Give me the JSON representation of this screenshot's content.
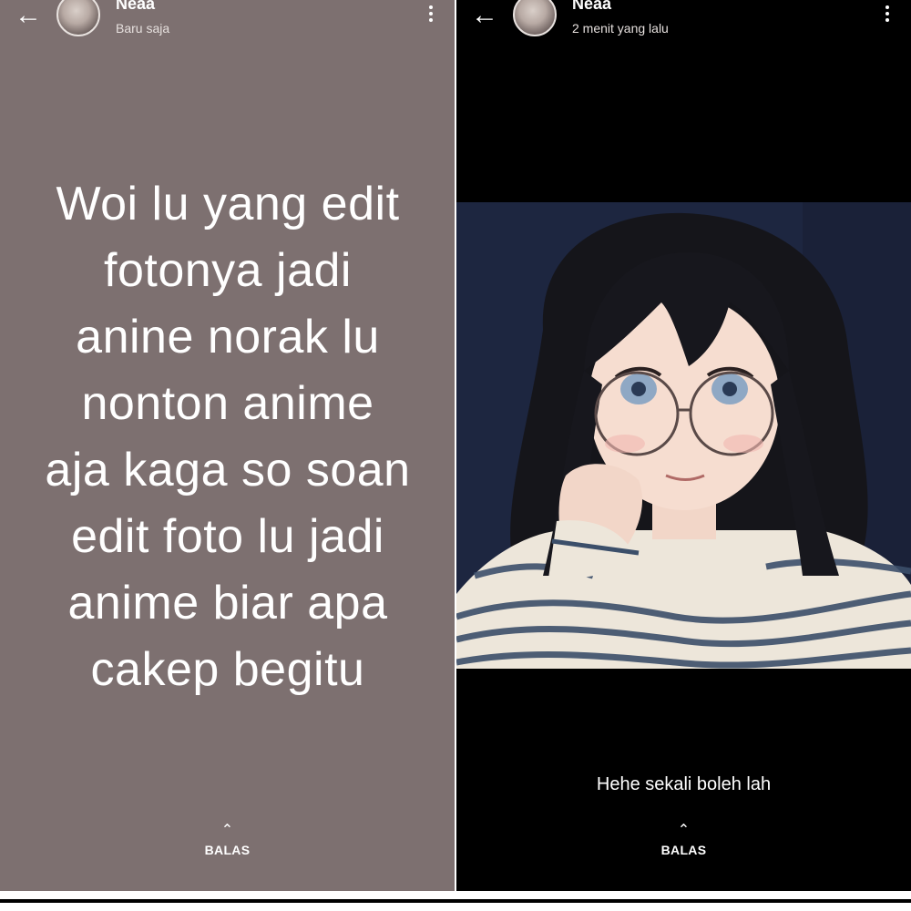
{
  "left_status": {
    "header": {
      "name": "Neaa",
      "time": "Baru saja"
    },
    "text_lines": [
      "Woi lu yang edit",
      "fotonya jadi",
      "anine norak lu",
      "nonton anime",
      "aja kaga so soan",
      "edit foto lu jadi",
      "anime biar apa",
      "cakep begitu"
    ],
    "reply_label": "BALAS",
    "background_color": "#7d7070"
  },
  "right_status": {
    "header": {
      "name": "Neaa",
      "time": "2 menit yang lalu"
    },
    "caption": "Hehe sekali boleh lah",
    "reply_label": "BALAS",
    "background_color": "#000000"
  },
  "icons": {
    "back": "arrow-left-icon",
    "menu": "more-vertical-icon",
    "reply": "chevron-up-icon"
  }
}
